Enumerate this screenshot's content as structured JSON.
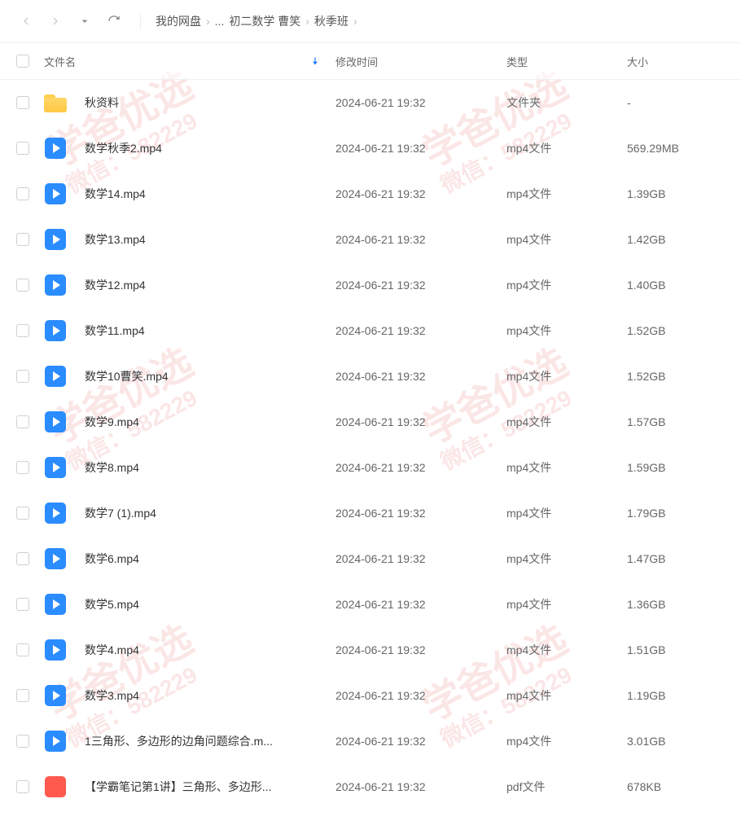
{
  "breadcrumb": {
    "root": "我的网盘",
    "ellipsis": "...",
    "mid": "初二数学 曹笑",
    "current": "秋季班"
  },
  "columns": {
    "name": "文件名",
    "time": "修改时间",
    "type": "类型",
    "size": "大小"
  },
  "files": [
    {
      "icon": "folder",
      "name": "秋资料",
      "time": "2024-06-21 19:32",
      "type": "文件夹",
      "size": "-"
    },
    {
      "icon": "video",
      "name": "数学秋季2.mp4",
      "time": "2024-06-21 19:32",
      "type": "mp4文件",
      "size": "569.29MB"
    },
    {
      "icon": "video",
      "name": "数学14.mp4",
      "time": "2024-06-21 19:32",
      "type": "mp4文件",
      "size": "1.39GB"
    },
    {
      "icon": "video",
      "name": "数学13.mp4",
      "time": "2024-06-21 19:32",
      "type": "mp4文件",
      "size": "1.42GB"
    },
    {
      "icon": "video",
      "name": "数学12.mp4",
      "time": "2024-06-21 19:32",
      "type": "mp4文件",
      "size": "1.40GB"
    },
    {
      "icon": "video",
      "name": "数学11.mp4",
      "time": "2024-06-21 19:32",
      "type": "mp4文件",
      "size": "1.52GB"
    },
    {
      "icon": "video",
      "name": "数学10曹笑.mp4",
      "time": "2024-06-21 19:32",
      "type": "mp4文件",
      "size": "1.52GB"
    },
    {
      "icon": "video",
      "name": "数学9.mp4",
      "time": "2024-06-21 19:32",
      "type": "mp4文件",
      "size": "1.57GB"
    },
    {
      "icon": "video",
      "name": "数学8.mp4",
      "time": "2024-06-21 19:32",
      "type": "mp4文件",
      "size": "1.59GB"
    },
    {
      "icon": "video",
      "name": "数学7 (1).mp4",
      "time": "2024-06-21 19:32",
      "type": "mp4文件",
      "size": "1.79GB"
    },
    {
      "icon": "video",
      "name": "数学6.mp4",
      "time": "2024-06-21 19:32",
      "type": "mp4文件",
      "size": "1.47GB"
    },
    {
      "icon": "video",
      "name": "数学5.mp4",
      "time": "2024-06-21 19:32",
      "type": "mp4文件",
      "size": "1.36GB"
    },
    {
      "icon": "video",
      "name": "数学4.mp4",
      "time": "2024-06-21 19:32",
      "type": "mp4文件",
      "size": "1.51GB"
    },
    {
      "icon": "video",
      "name": "数学3.mp4",
      "time": "2024-06-21 19:32",
      "type": "mp4文件",
      "size": "1.19GB"
    },
    {
      "icon": "video",
      "name": "1三角形、多边形的边角问题综合.m...",
      "time": "2024-06-21 19:32",
      "type": "mp4文件",
      "size": "3.01GB"
    },
    {
      "icon": "pdf",
      "name": "【学霸笔记第1讲】三角形、多边形...",
      "time": "2024-06-21 19:32",
      "type": "pdf文件",
      "size": "678KB"
    }
  ],
  "watermark": {
    "line1": "学爸优选",
    "line2": "微信：582229"
  }
}
